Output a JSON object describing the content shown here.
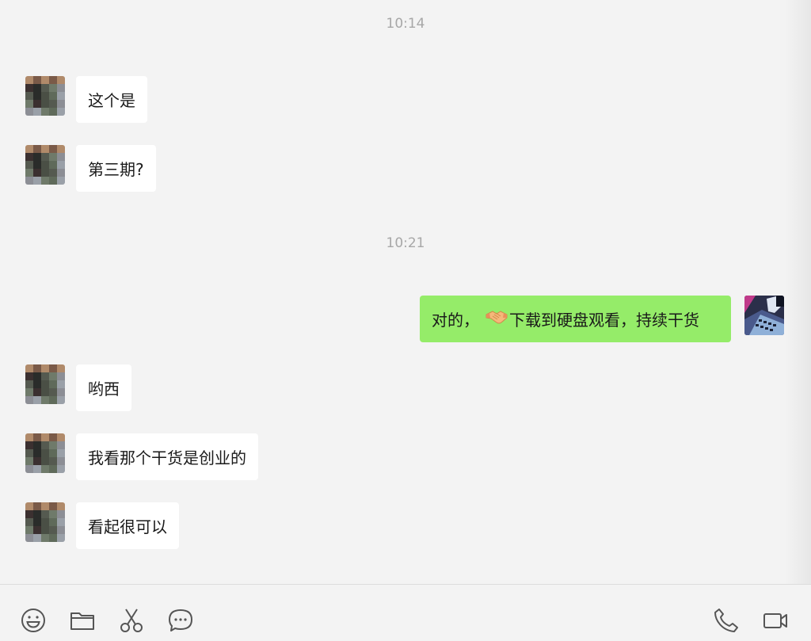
{
  "timestamps": [
    "10:14",
    "10:21"
  ],
  "messages": [
    {
      "side": "in",
      "text": "这个是"
    },
    {
      "side": "in",
      "text": "第三期?"
    },
    {
      "side": "out",
      "text_before": "对的，",
      "emoji": "handshake",
      "text_after": "下载到硬盘观看，持续干货"
    },
    {
      "side": "in",
      "text": "哟西"
    },
    {
      "side": "in",
      "text": "我看那个干货是创业的"
    },
    {
      "side": "in",
      "text": "看起很可以"
    }
  ],
  "toolbar": {
    "left_icons": [
      "emoji-icon",
      "folder-icon",
      "scissors-icon",
      "chat-bubble-icon"
    ],
    "right_icons": [
      "phone-icon",
      "video-call-icon"
    ]
  },
  "colors": {
    "background": "#f3f3f3",
    "incoming_bubble": "#ffffff",
    "outgoing_bubble": "#95ec69",
    "timestamp": "#a7a7a7"
  }
}
